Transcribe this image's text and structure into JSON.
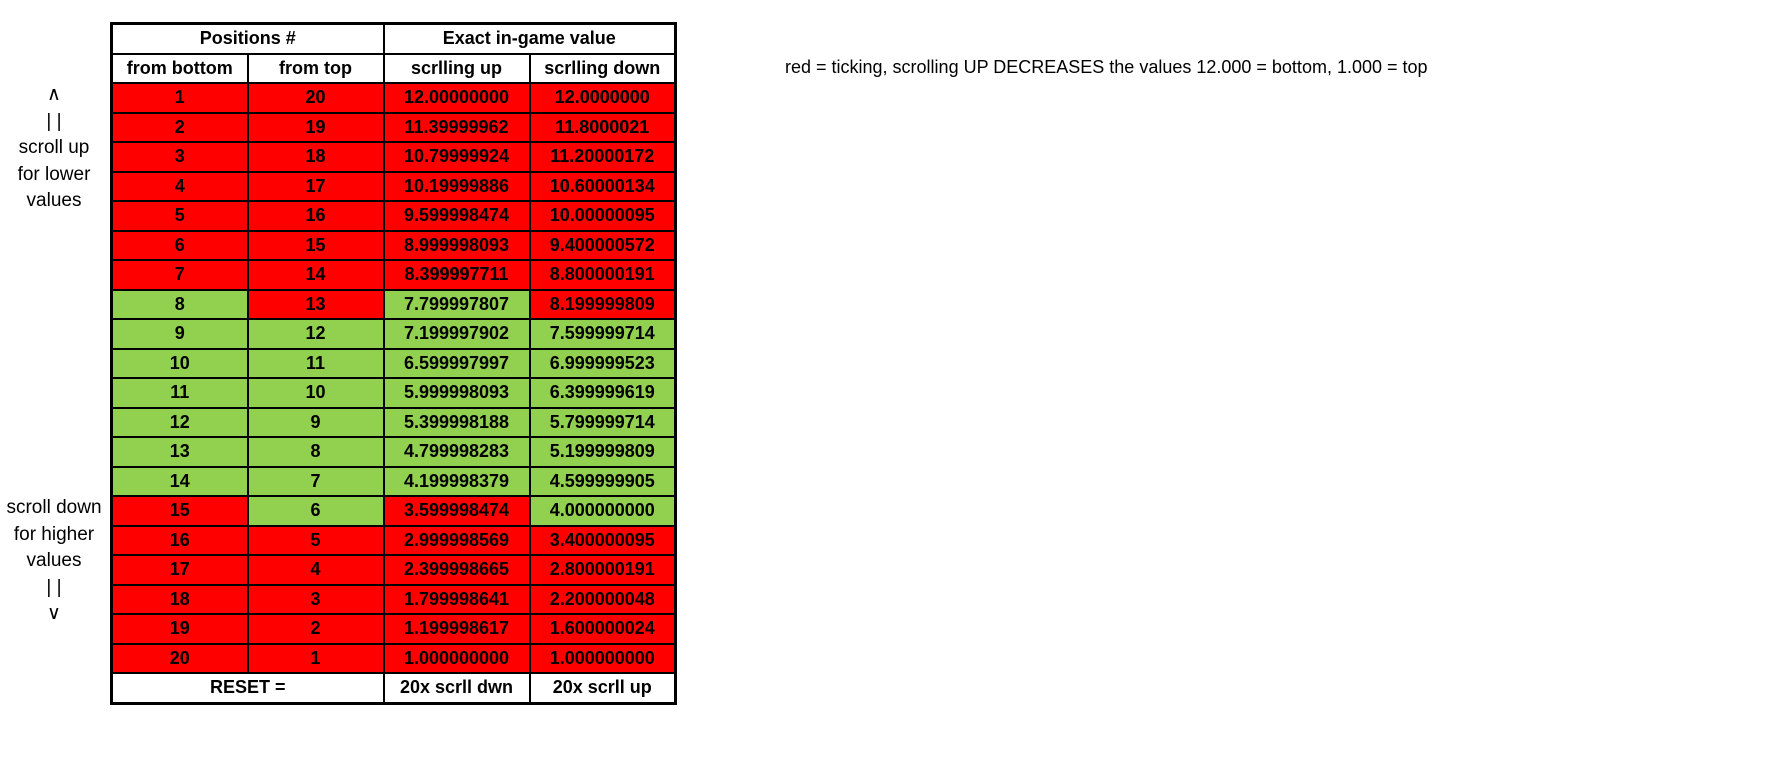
{
  "legend": {
    "note": "red = ticking, scrolling UP DECREASES the values 12.000 = bottom, 1.000 = top"
  },
  "annotations": {
    "up": "∧\n| |\nscroll up\nfor lower\nvalues",
    "down": "scroll down\nfor higher\nvalues\n| |\n∨"
  },
  "table": {
    "group_headers": [
      {
        "label": "Positions #",
        "span": 2
      },
      {
        "label": "Exact in-game value",
        "span": 2
      }
    ],
    "column_headers": [
      "from bottom",
      "from top",
      "scrlling up",
      "scrlling down"
    ],
    "footer": {
      "reset_label": "RESET =",
      "scrlling_up_action": "20x scrll dwn",
      "scrlling_down_action": "20x scrll up"
    },
    "rows": [
      {
        "from_bottom": "1",
        "from_top": "20",
        "scrlling_up": "12.00000000",
        "scrlling_down": "12.0000000",
        "up_state": "red",
        "down_state": "red",
        "up_bold": true,
        "down_bold": false,
        "pos_state": "red"
      },
      {
        "from_bottom": "2",
        "from_top": "19",
        "scrlling_up": "11.39999962",
        "scrlling_down": "11.8000021",
        "up_state": "red",
        "down_state": "red",
        "up_bold": false,
        "down_bold": false,
        "pos_state": "red"
      },
      {
        "from_bottom": "3",
        "from_top": "18",
        "scrlling_up": "10.79999924",
        "scrlling_down": "11.20000172",
        "up_state": "red",
        "down_state": "red",
        "up_bold": false,
        "down_bold": false,
        "pos_state": "red"
      },
      {
        "from_bottom": "4",
        "from_top": "17",
        "scrlling_up": "10.19999886",
        "scrlling_down": "10.60000134",
        "up_state": "red",
        "down_state": "red",
        "up_bold": false,
        "down_bold": false,
        "pos_state": "red"
      },
      {
        "from_bottom": "5",
        "from_top": "16",
        "scrlling_up": "9.599998474",
        "scrlling_down": "10.00000095",
        "up_state": "red",
        "down_state": "red",
        "up_bold": false,
        "down_bold": false,
        "pos_state": "red"
      },
      {
        "from_bottom": "6",
        "from_top": "15",
        "scrlling_up": "8.999998093",
        "scrlling_down": "9.400000572",
        "up_state": "red",
        "down_state": "red",
        "up_bold": false,
        "down_bold": false,
        "pos_state": "red"
      },
      {
        "from_bottom": "7",
        "from_top": "14",
        "scrlling_up": "8.399997711",
        "scrlling_down": "8.800000191",
        "up_state": "red",
        "down_state": "red",
        "up_bold": false,
        "down_bold": false,
        "pos_state": "red"
      },
      {
        "from_bottom": "8",
        "from_top": "13",
        "scrlling_up": "7.799997807",
        "scrlling_down": "8.199999809",
        "up_state": "green",
        "down_state": "red",
        "up_bold": false,
        "down_bold": false,
        "pos_state": "split-8"
      },
      {
        "from_bottom": "9",
        "from_top": "12",
        "scrlling_up": "7.199997902",
        "scrlling_down": "7.599999714",
        "up_state": "green",
        "down_state": "green",
        "up_bold": false,
        "down_bold": false,
        "pos_state": "green"
      },
      {
        "from_bottom": "10",
        "from_top": "11",
        "scrlling_up": "6.599997997",
        "scrlling_down": "6.999999523",
        "up_state": "green",
        "down_state": "green",
        "up_bold": false,
        "down_bold": false,
        "pos_state": "green"
      },
      {
        "from_bottom": "11",
        "from_top": "10",
        "scrlling_up": "5.999998093",
        "scrlling_down": "6.399999619",
        "up_state": "green",
        "down_state": "green",
        "up_bold": false,
        "down_bold": false,
        "pos_state": "green"
      },
      {
        "from_bottom": "12",
        "from_top": "9",
        "scrlling_up": "5.399998188",
        "scrlling_down": "5.799999714",
        "up_state": "green",
        "down_state": "green",
        "up_bold": false,
        "down_bold": false,
        "pos_state": "green"
      },
      {
        "from_bottom": "13",
        "from_top": "8",
        "scrlling_up": "4.799998283",
        "scrlling_down": "5.199999809",
        "up_state": "green",
        "down_state": "green",
        "up_bold": false,
        "down_bold": false,
        "pos_state": "green"
      },
      {
        "from_bottom": "14",
        "from_top": "7",
        "scrlling_up": "4.199998379",
        "scrlling_down": "4.599999905",
        "up_state": "green",
        "down_state": "green",
        "up_bold": false,
        "down_bold": false,
        "pos_state": "green"
      },
      {
        "from_bottom": "15",
        "from_top": "6",
        "scrlling_up": "3.599998474",
        "scrlling_down": "4.000000000",
        "up_state": "red",
        "down_state": "green",
        "up_bold": false,
        "down_bold": false,
        "pos_state": "split-15"
      },
      {
        "from_bottom": "16",
        "from_top": "5",
        "scrlling_up": "2.999998569",
        "scrlling_down": "3.400000095",
        "up_state": "red",
        "down_state": "red",
        "up_bold": false,
        "down_bold": false,
        "pos_state": "red"
      },
      {
        "from_bottom": "17",
        "from_top": "4",
        "scrlling_up": "2.399998665",
        "scrlling_down": "2.800000191",
        "up_state": "red",
        "down_state": "red",
        "up_bold": false,
        "down_bold": false,
        "pos_state": "red"
      },
      {
        "from_bottom": "18",
        "from_top": "3",
        "scrlling_up": "1.799998641",
        "scrlling_down": "2.200000048",
        "up_state": "red",
        "down_state": "red",
        "up_bold": false,
        "down_bold": false,
        "pos_state": "red"
      },
      {
        "from_bottom": "19",
        "from_top": "2",
        "scrlling_up": "1.199998617",
        "scrlling_down": "1.600000024",
        "up_state": "red",
        "down_state": "red",
        "up_bold": false,
        "down_bold": false,
        "pos_state": "red"
      },
      {
        "from_bottom": "20",
        "from_top": "1",
        "scrlling_up": "1.000000000",
        "scrlling_down": "1.000000000",
        "up_state": "red",
        "down_state": "red",
        "up_bold": false,
        "down_bold": true,
        "pos_state": "red"
      }
    ]
  },
  "colors": {
    "red": "#ff0000",
    "green": "#92d050",
    "border": "#000000",
    "background": "#ffffff",
    "text": "#000000"
  }
}
